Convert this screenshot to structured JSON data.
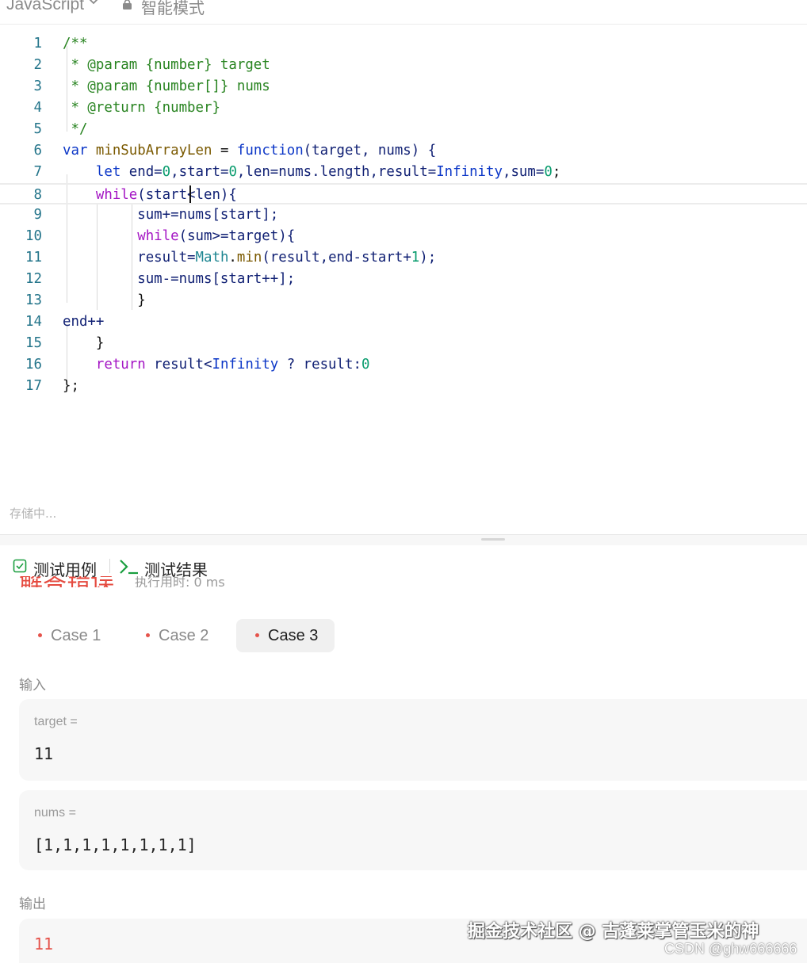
{
  "toolbar": {
    "language": "JavaScript",
    "mode": "智能模式"
  },
  "editor": {
    "lines": [
      {
        "n": "1"
      },
      {
        "n": "2"
      },
      {
        "n": "3"
      },
      {
        "n": "4"
      },
      {
        "n": "5"
      },
      {
        "n": "6"
      },
      {
        "n": "7"
      },
      {
        "n": "8"
      },
      {
        "n": "9"
      },
      {
        "n": "10"
      },
      {
        "n": "11"
      },
      {
        "n": "12"
      },
      {
        "n": "13"
      },
      {
        "n": "14"
      },
      {
        "n": "15"
      },
      {
        "n": "16"
      },
      {
        "n": "17"
      }
    ],
    "code": {
      "l1": "/**",
      "l2": " * @param {number} target",
      "l3": " * @param {number[]} nums",
      "l4": " * @return {number}",
      "l5": " */",
      "l6_kw": "var ",
      "l6_fn": "minSubArrayLen",
      "l6_eq": " = ",
      "l6_fkw": "function",
      "l6_rest": "(target, nums) {",
      "l7_kw": "    let ",
      "l7_a": "end=",
      "l7_n1": "0",
      "l7_b": ",start=",
      "l7_n2": "0",
      "l7_c": ",len=nums.length,result=",
      "l7_inf": "Infinity",
      "l7_d": ",sum=",
      "l7_n3": "0",
      "l7_e": ";",
      "l8_kw": "    while",
      "l8_rest": "(start<len){",
      "l9": "         sum+=nums[start];",
      "l10_kw": "         while",
      "l10_rest": "(sum>=target){",
      "l11_a": "         result=",
      "l11_math": "Math",
      "l11_dot": ".",
      "l11_min": "min",
      "l11_b": "(result,end-start+",
      "l11_n": "1",
      "l11_c": ");",
      "l12": "         sum-=nums[start++];",
      "l13": "         }",
      "l14": "end++",
      "l15": "    }",
      "l16_kw": "    return ",
      "l16_a": "result<",
      "l16_inf": "Infinity",
      "l16_b": " ? result:",
      "l16_n": "0",
      "l17": "};"
    },
    "status": "存储中..."
  },
  "panel": {
    "tab_cases": "测试用例",
    "tab_result": "测试结果",
    "result_title": "解答错误",
    "result_sub": "执行用时: 0 ms",
    "cases": [
      "Case 1",
      "Case 2",
      "Case 3"
    ],
    "input_label": "输入",
    "output_label": "输出",
    "inputs": [
      {
        "name": "target =",
        "value": "11"
      },
      {
        "name": "nums =",
        "value": "[1,1,1,1,1,1,1,1]"
      }
    ],
    "output_value": "11"
  },
  "watermark": {
    "line1": "掘金技术社区 @ 古蓬莱掌管玉米的神",
    "line2": "CSDN @ghw666666"
  },
  "colors": {
    "error": "#e5534b",
    "accent_green": "#1a9e3f"
  },
  "icons": [
    "chevron-down-icon",
    "lock-icon",
    "checkbox-icon",
    "terminal-icon"
  ]
}
